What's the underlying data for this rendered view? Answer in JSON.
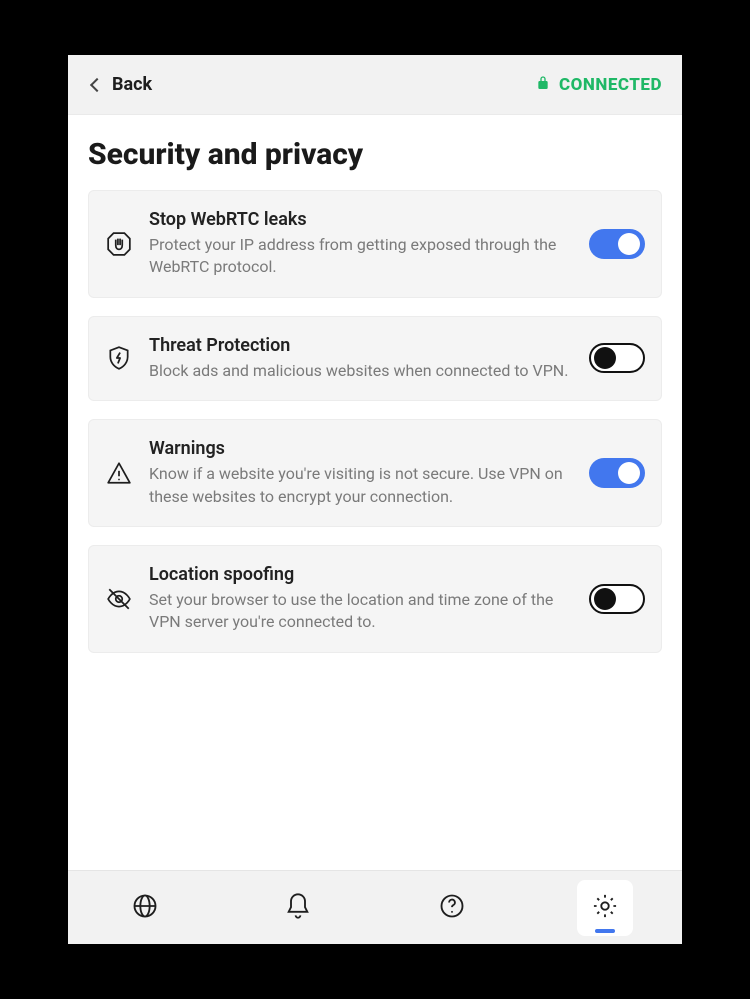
{
  "header": {
    "back_label": "Back",
    "status_label": "CONNECTED"
  },
  "page": {
    "title": "Security and privacy"
  },
  "settings": [
    {
      "id": "stop-webrtc",
      "title": "Stop WebRTC leaks",
      "description": "Protect your IP address from getting exposed through the WebRTC protocol.",
      "enabled": true
    },
    {
      "id": "threat-protection",
      "title": "Threat Protection",
      "description": "Block ads and malicious websites when connected to VPN.",
      "enabled": false
    },
    {
      "id": "warnings",
      "title": "Warnings",
      "description": "Know if a website you're visiting is not secure. Use VPN on these websites to encrypt your connection.",
      "enabled": true
    },
    {
      "id": "location-spoofing",
      "title": "Location spoofing",
      "description": "Set your browser to use the location and time zone of the VPN server you're connected to.",
      "enabled": false
    }
  ],
  "nav": {
    "active": "settings"
  },
  "colors": {
    "accent": "#4277ee",
    "status": "#1fb866"
  }
}
